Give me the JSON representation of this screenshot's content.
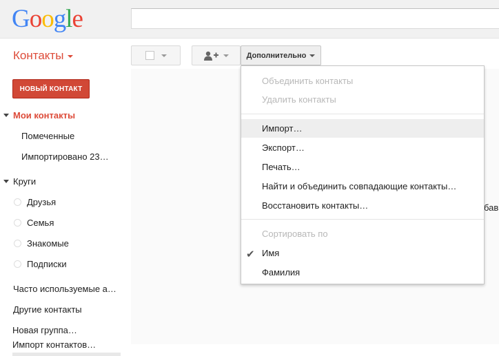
{
  "logo": {
    "letters": [
      "G",
      "o",
      "o",
      "g",
      "l",
      "e"
    ],
    "colors": [
      "#4285f4",
      "#ea4335",
      "#fbbc05",
      "#4285f4",
      "#34a853",
      "#ea4335"
    ]
  },
  "header": {
    "app_title": "Контакты"
  },
  "toolbar": {
    "more_label": "Дополнительно"
  },
  "sidebar": {
    "new_contact": "НОВЫЙ КОНТАКТ",
    "my_contacts": "Мои контакты",
    "starred": "Помеченные",
    "imported": "Импортировано 23…",
    "circles": "Круги",
    "circle_items": [
      "Друзья",
      "Семья",
      "Знакомые",
      "Подписки"
    ],
    "frequent": "Часто используемые а…",
    "other": "Другие контакты",
    "new_group": "Новая группа…",
    "import_contacts": "Импорт контактов…"
  },
  "main": {
    "peek_text": "бави"
  },
  "menu": {
    "merge": "Объединить контакты",
    "delete": "Удалить контакты",
    "import": "Импорт…",
    "export": "Экспорт…",
    "print": "Печать…",
    "find_merge": "Найти и объединить совпадающие контакты…",
    "restore": "Восстановить контакты…",
    "sort_header": "Сортировать по",
    "sort_first": "Имя",
    "sort_last": "Фамилия",
    "check_glyph": "✔"
  },
  "colors": {
    "accent": "#dd4b39",
    "button_red": "#d14836"
  }
}
